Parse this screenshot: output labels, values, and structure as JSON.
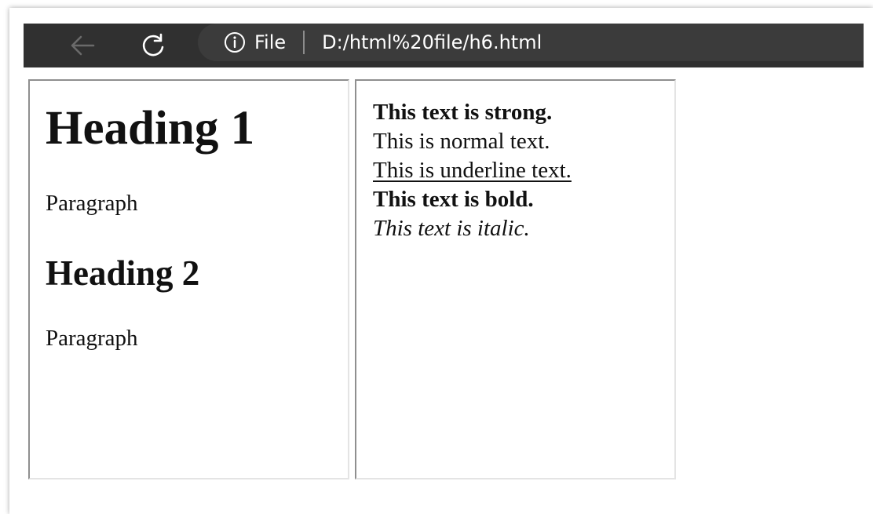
{
  "browser": {
    "back_icon": "arrow-left-icon",
    "reload_icon": "reload-icon",
    "info_icon": "info-circle-icon",
    "scheme_label": "File",
    "url": "D:/html%20file/h6.html",
    "toolbar_color": "#303030",
    "address_bar_color": "#3b3b3b"
  },
  "left_panel": {
    "heading1": "Heading 1",
    "paragraph1": "Paragraph",
    "heading2": "Heading 2",
    "paragraph2": "Paragraph"
  },
  "right_panel": {
    "strong_text": "This text is strong.",
    "normal_text": "This is normal text.",
    "underline_text": "This is underline text.",
    "bold_text": "This text is bold.",
    "italic_text": "This text is italic."
  }
}
